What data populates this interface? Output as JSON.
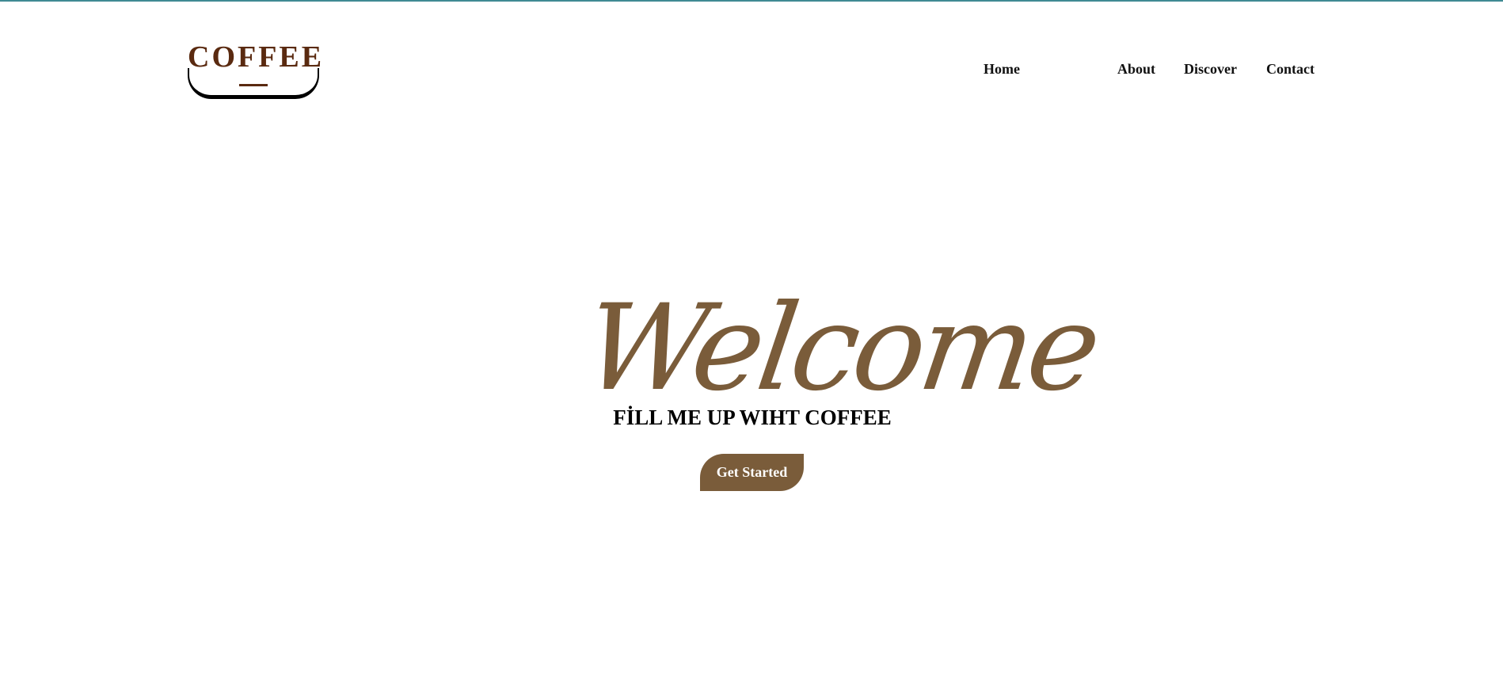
{
  "brand": {
    "logo_text": "COFFEE",
    "colors": {
      "logo": "#5a2a10",
      "accent": "#7a5c3a",
      "top_rule": "#3f8a93"
    }
  },
  "nav": {
    "items": [
      {
        "label": "Home"
      },
      {
        "label": "About"
      },
      {
        "label": "Discover"
      },
      {
        "label": "Contact"
      }
    ]
  },
  "hero": {
    "heading": "Welcome",
    "tagline": "FİLL ME UP WIHT COFFEE",
    "cta_label": "Get Started"
  }
}
